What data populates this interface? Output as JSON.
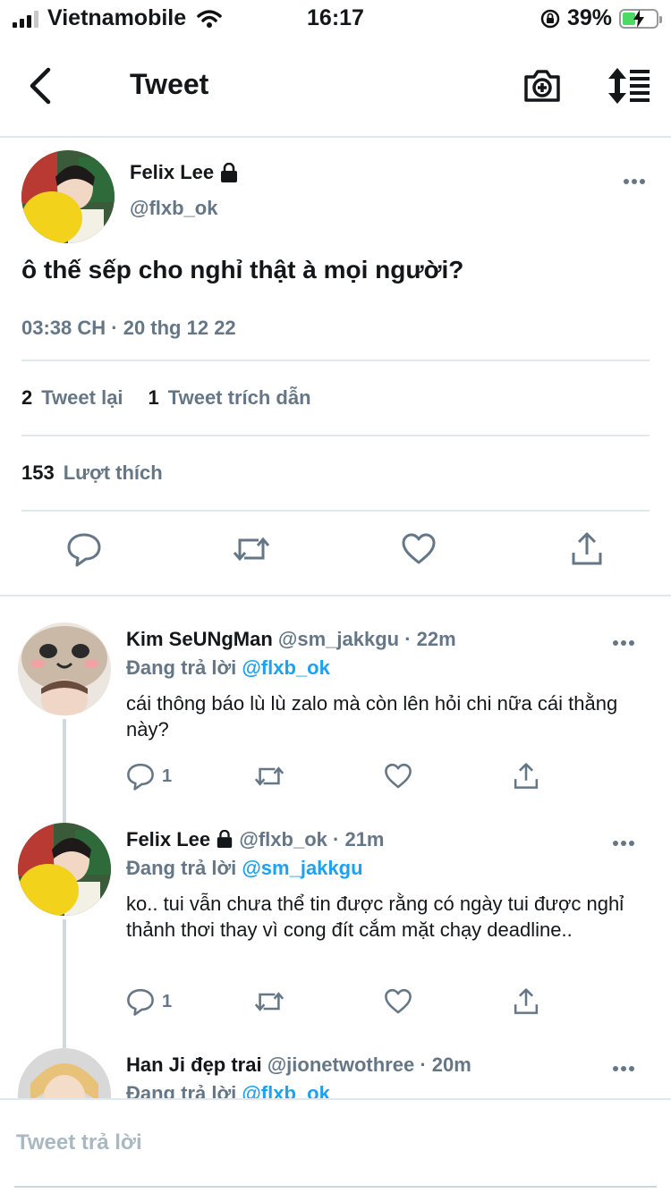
{
  "status_bar": {
    "carrier": "Vietnamobile",
    "time": "16:17",
    "battery": "39%",
    "battery_level": 0.39
  },
  "nav": {
    "title": "Tweet"
  },
  "tweet": {
    "name": "Felix Lee",
    "handle": "@flxb_ok",
    "text": "ô thế sếp cho nghỉ thật à mọi người?",
    "time": "03:38 CH · 20 thg 12 22",
    "retweets_count": "2",
    "retweets_label": "Tweet lại",
    "quotes_count": "1",
    "quotes_label": "Tweet trích dẫn",
    "likes_count": "153",
    "likes_label": "Lượt thích"
  },
  "replies": [
    {
      "name": "Kim SeUNgMan",
      "handle": "@sm_jakkgu",
      "time": "· 22m",
      "replying_label": "Đang trả lời",
      "replying_to": "@flxb_ok",
      "text": "cái thông báo lù lù zalo mà còn lên hỏi chi nữa cái thằng này?",
      "reply_count": "1"
    },
    {
      "name": "Felix Lee",
      "handle": "@flxb_ok",
      "time": "· 21m",
      "replying_label": "Đang trả lời",
      "replying_to": "@sm_jakkgu",
      "text": "ko.. tui vẫn chưa thể tin được rằng có ngày tui được nghỉ thảnh thơi thay vì cong đít cắm mặt chạy deadline..",
      "reply_count": "1"
    },
    {
      "name": "Han Ji đẹp trai",
      "handle": "@jionetwothree",
      "time": "· 20m",
      "replying_label": "Đang trả lời",
      "replying_to": "@flxb_ok"
    }
  ],
  "compose": {
    "placeholder": "Tweet trả lời"
  },
  "icons": {
    "back": "chevron-left-icon",
    "camera": "camera-plus-icon",
    "sort": "sort-icon",
    "reply": "reply-icon",
    "retweet": "retweet-icon",
    "like": "heart-icon",
    "share": "share-icon",
    "more": "more-icon",
    "lock": "lock-icon"
  },
  "colors": {
    "accent": "#1da1f2",
    "muted": "#657786",
    "divider": "#e1e8ed",
    "battery": "#4cd964"
  }
}
